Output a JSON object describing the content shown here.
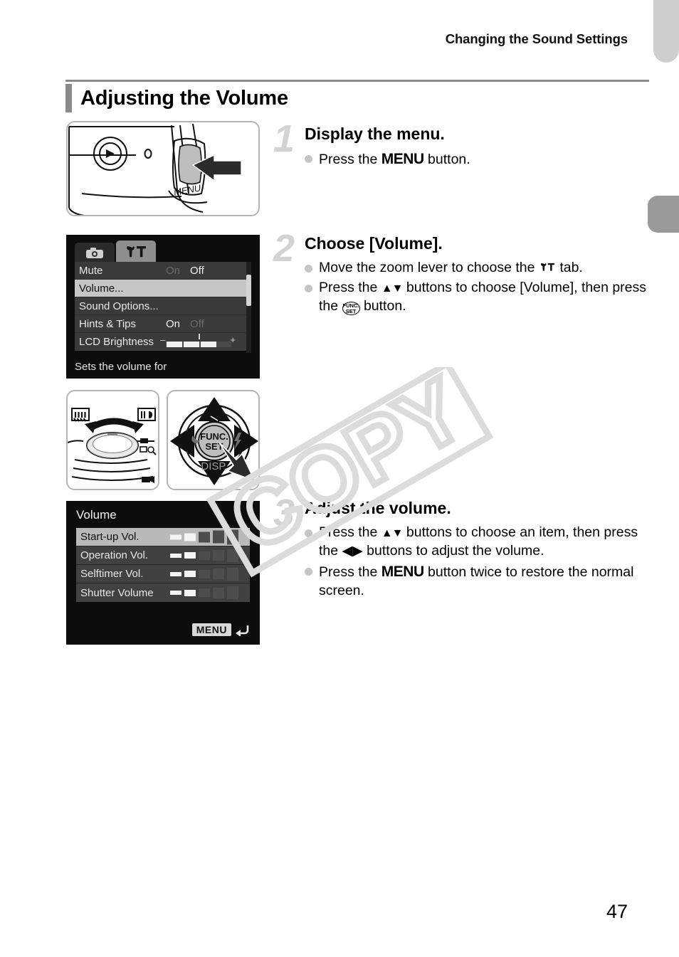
{
  "header": {
    "running_title": "Changing the Sound Settings"
  },
  "section": {
    "title": "Adjusting the Volume"
  },
  "watermark": {
    "text": "COPY"
  },
  "figures": {
    "menu_button": {
      "name": "camera-rear-menu-button",
      "button_label": "MENU"
    },
    "zoom_lever": {
      "name": "camera-zoom-lever",
      "wide_label": "W",
      "tele_label": "T"
    },
    "dpad": {
      "name": "camera-four-way-controller",
      "center_label_top": "FUNC.",
      "center_label_bottom": "SET",
      "disp_label": "DISP."
    }
  },
  "setup_screen": {
    "tabs": [
      {
        "icon": "camera-icon",
        "active": false
      },
      {
        "icon": "setup-wrench-hammer-icon",
        "active": true
      }
    ],
    "rows": [
      {
        "label": "Mute",
        "on": "On",
        "off": "Off",
        "selected_value": "off",
        "selected": false
      },
      {
        "label": "Volume...",
        "on": "",
        "off": "",
        "selected_value": "",
        "selected": true
      },
      {
        "label": "Sound Options...",
        "on": "",
        "off": "",
        "selected_value": "",
        "selected": false
      },
      {
        "label": "Hints & Tips",
        "on": "On",
        "off": "Off",
        "selected_value": "on",
        "selected": false
      },
      {
        "label": "LCD Brightness",
        "on": "",
        "off": "",
        "selected_value": "slider",
        "selected": false
      }
    ],
    "slider": {
      "minus": "–",
      "plus": "+",
      "filled_segments": 3,
      "total_segments": 4
    },
    "hint": "Sets the volume for"
  },
  "volume_screen": {
    "title": "Volume",
    "rows": [
      {
        "label": "Start-up Vol.",
        "level": 2,
        "max": 5,
        "selected": true
      },
      {
        "label": "Operation Vol.",
        "level": 2,
        "max": 5,
        "selected": false
      },
      {
        "label": "Selftimer Vol.",
        "level": 2,
        "max": 5,
        "selected": false
      },
      {
        "label": "Shutter Volume",
        "level": 2,
        "max": 5,
        "selected": false
      }
    ],
    "menu_button_label": "MENU",
    "back_arrow_icon": "return-arrow-icon"
  },
  "steps": [
    {
      "number": "1",
      "title": "Display the menu.",
      "bullets": [
        {
          "pre": "Press the ",
          "glyph": "MENU",
          "post": " button."
        }
      ]
    },
    {
      "number": "2",
      "title": "Choose [Volume].",
      "bullets": [
        {
          "pre": "Move the zoom lever to choose the ",
          "glyph": "setup-tab-icon",
          "post": " tab."
        },
        {
          "pre": "Press the ",
          "glyph": "up-down-arrows",
          "post": " buttons to choose [Volume], then press the ",
          "glyph2": "FUNC.SET",
          "post2": " button."
        }
      ]
    },
    {
      "number": "3",
      "title": "Adjust the volume.",
      "bullets": [
        {
          "pre": "Press the ",
          "glyph": "up-down-arrows",
          "post": " buttons to choose an item, then press the ",
          "glyph2": "left-right-arrows",
          "post2": " buttons to adjust the volume."
        },
        {
          "pre": "Press the ",
          "glyph": "MENU",
          "post": " button twice to restore the normal screen."
        }
      ]
    }
  ],
  "page": {
    "number": "47"
  },
  "colors": {
    "rule": "#8a8a8a",
    "step_number": "#d3d3d3",
    "bullet_dot": "#c5c5c5",
    "screen_bg": "#0d0d0d",
    "selected_row": "#c6c6c6",
    "edge_tab_light": "#cfcfcf",
    "edge_tab_dark": "#9a9a9a"
  }
}
